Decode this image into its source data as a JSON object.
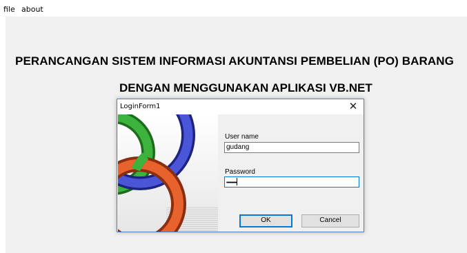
{
  "menu": {
    "file": "file",
    "about": "about"
  },
  "main": {
    "title_line1": "PERANCANGAN SISTEM INFORMASI AKUNTANSI PEMBELIAN (PO) BARANG",
    "title_line2": "DENGAN MENGGUNAKAN APLIKASI VB.NET"
  },
  "login": {
    "window_title": "LoginForm1",
    "close_glyph": "✕",
    "username_label": "User name",
    "username_value": "gudang",
    "password_label": "Password",
    "password_value": "••••••••••",
    "ok_label": "OK",
    "cancel_label": "Cancel"
  },
  "colors": {
    "ring_green": "#2e9a2e",
    "ring_blue": "#3b45c8",
    "ring_orange": "#e0582a"
  }
}
